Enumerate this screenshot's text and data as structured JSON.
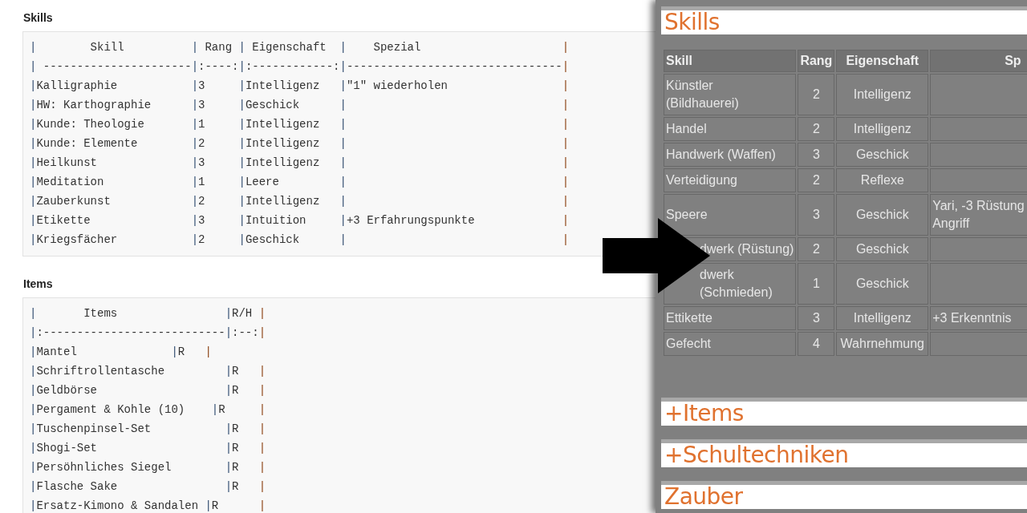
{
  "markdown_blocks": [
    {
      "title": "Skills",
      "lines": [
        [
          "|        Skill          | Rang | Eigenschaft  ",
          "|    Spezial                     ",
          "|"
        ],
        [
          "| ----------------------|:----:|:------------:|--------------------------------|"
        ],
        [
          "|Kalligraphie           ",
          "|3     ",
          "|Intelligenz   ",
          "|\"1\" wiederholen                 ",
          "|"
        ],
        [
          "|HW: Karthographie      ",
          "|3     ",
          "|Geschick      ",
          "|                                ",
          "|"
        ],
        [
          "|Kunde: Theologie       ",
          "|1     ",
          "|Intelligenz   ",
          "|                                ",
          "|"
        ],
        [
          "|Kunde: Elemente        ",
          "|2     ",
          "|Intelligenz   ",
          "|                                ",
          "|"
        ],
        [
          "|Heilkunst              ",
          "|3     ",
          "|Intelligenz   ",
          "|                                ",
          "|"
        ],
        [
          "|Meditation             ",
          "|1     ",
          "|Leere         ",
          "|                                ",
          "|"
        ],
        [
          "|Zauberkunst            ",
          "|2     ",
          "|Intelligenz   ",
          "|                                ",
          "|"
        ],
        [
          "|Etikette               ",
          "|3     ",
          "|Intuition     ",
          "|+3 Erfahrungspunkte             ",
          "|"
        ],
        [
          "|Kriegsfächer           ",
          "|2     ",
          "|Geschick      ",
          "|                                ",
          "|"
        ]
      ]
    },
    {
      "title": "Items",
      "lines": [
        [
          "|       Items                ",
          "|R/H ",
          "|"
        ],
        [
          "|:---------------------------|:--:|"
        ],
        [
          "|Mantel              ",
          "|R   ",
          "|"
        ],
        [
          "|Schriftrollentasche         ",
          "|R   ",
          "|"
        ],
        [
          "|Geldbörse                   ",
          "|R   ",
          "|"
        ],
        [
          "|Pergament & Kohle (10)    ",
          "|R     ",
          "|"
        ],
        [
          "|Tuschenpinsel-Set           ",
          "|R   ",
          "|"
        ],
        [
          "|Shogi-Set                   ",
          "|R   ",
          "|"
        ],
        [
          "|Persöhnliches Siegel        ",
          "|R   ",
          "|"
        ],
        [
          "|Flasche Sake                ",
          "|R   ",
          "|"
        ],
        [
          "|Ersatz-Kimono & Sandalen ",
          "|R      ",
          "|"
        ]
      ]
    }
  ],
  "preview_sections": [
    {
      "kind": "table",
      "title": "Skills",
      "columns": [
        "Skill",
        "Rang",
        "Eigenschaft",
        "Sp"
      ],
      "rows": [
        {
          "covered": false,
          "cells": [
            "Künstler (Bildhauerei)",
            "2",
            "Intelligenz",
            ""
          ]
        },
        {
          "covered": false,
          "cells": [
            "Handel",
            "2",
            "Intelligenz",
            ""
          ]
        },
        {
          "covered": false,
          "cells": [
            "Handwerk (Waffen)",
            "3",
            "Geschick",
            ""
          ]
        },
        {
          "covered": false,
          "cells": [
            "Verteidigung",
            "2",
            "Reflexe",
            ""
          ]
        },
        {
          "covered": false,
          "cells": [
            "Speere",
            "3",
            "Geschick",
            "Yari, -3 Rüstung\nAngriff"
          ]
        },
        {
          "covered": true,
          "cells": [
            "dwerk (Rüstung)",
            "2",
            "Geschick",
            ""
          ]
        },
        {
          "covered": true,
          "cells": [
            "dwerk\n(Schmieden)",
            "1",
            "Geschick",
            ""
          ]
        },
        {
          "covered": false,
          "cells": [
            "Ettikette",
            "3",
            "Intelligenz",
            "+3 Erkenntnis"
          ]
        },
        {
          "covered": false,
          "cells": [
            "Gefecht",
            "4",
            "Wahrnehmung",
            ""
          ]
        }
      ]
    },
    {
      "kind": "heading",
      "title": "+Items"
    },
    {
      "kind": "heading",
      "title": "+Schultechniken"
    },
    {
      "kind": "heading",
      "title": "Zauber"
    }
  ]
}
